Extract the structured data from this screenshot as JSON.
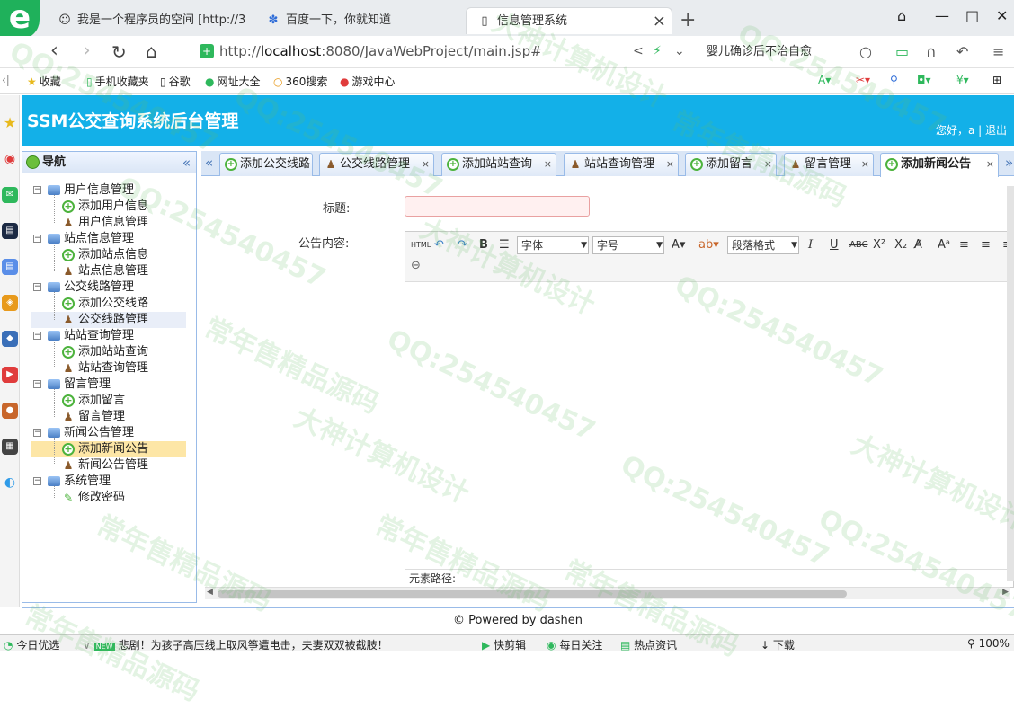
{
  "browser": {
    "logo": "e",
    "tabs": [
      {
        "label": "我是一个程序员的空间 [http://3"
      },
      {
        "label": "百度一下，你就知道"
      },
      {
        "label": "信息管理系统"
      }
    ],
    "new_tab": "+",
    "url_prefix": "http://",
    "url_host": "localhost",
    "url_rest": ":8080/JavaWebProject/main.jsp#",
    "search_text": "婴儿确诊后不治自愈",
    "bookmarks": [
      "收藏",
      "手机收藏夹",
      "谷歌",
      "网址大全",
      "360搜索",
      "游戏中心"
    ]
  },
  "app": {
    "title": "SSM公交查询系统后台管理",
    "greeting": "您好，a",
    "logout": "退出"
  },
  "nav": {
    "title": "导航",
    "groups": [
      {
        "label": "用户信息管理",
        "items": [
          "添加用户信息",
          "用户信息管理"
        ]
      },
      {
        "label": "站点信息管理",
        "items": [
          "添加站点信息",
          "站点信息管理"
        ]
      },
      {
        "label": "公交线路管理",
        "items": [
          "添加公交线路",
          "公交线路管理"
        ]
      },
      {
        "label": "站站查询管理",
        "items": [
          "添加站站查询",
          "站站查询管理"
        ]
      },
      {
        "label": "留言管理",
        "items": [
          "添加留言",
          "留言管理"
        ]
      },
      {
        "label": "新闻公告管理",
        "items": [
          "添加新闻公告",
          "新闻公告管理"
        ]
      },
      {
        "label": "系统管理",
        "items": [
          "修改密码"
        ]
      }
    ]
  },
  "tabs": [
    "添加公交线路",
    "公交线路管理",
    "添加站站查询",
    "站站查询管理",
    "添加留言",
    "留言管理",
    "添加新闻公告"
  ],
  "form": {
    "title_label": "标题:",
    "content_label": "公告内容:",
    "title_value": "",
    "font_label": "字体",
    "size_label": "字号",
    "para_label": "段落格式",
    "element_path": "元素路径:"
  },
  "footer": "© Powered by dashen",
  "statusbar": {
    "left": "今日优选",
    "news_badge": "NEW",
    "news": "悲剧！为孩子高压线上取风筝遭电击，夫妻双双被截肢！",
    "items": [
      "快剪辑",
      "每日关注",
      "热点资讯",
      "下载"
    ],
    "zoom": "100%"
  },
  "watermarks": [
    "QQ:254540457",
    "大神计算机设计",
    "常年售精品源码"
  ]
}
